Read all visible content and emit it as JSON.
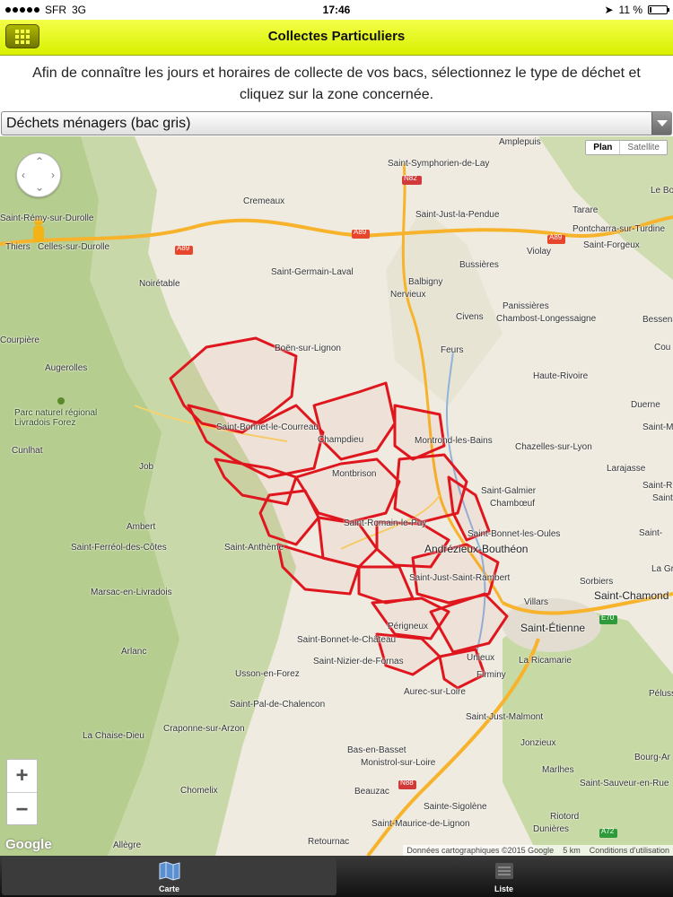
{
  "status": {
    "carrier": "SFR",
    "network": "3G",
    "time": "17:46",
    "battery": "11 %",
    "battery_level": 0.11
  },
  "nav": {
    "title": "Collectes Particuliers",
    "menu_icon": "grid-icon"
  },
  "intro": "Afin de connaître les jours et horaires de collecte de vos bacs, sélectionnez le type de déchet et cliquez sur la zone concernée.",
  "waste_select": {
    "value": "Déchets ménagers (bac gris)"
  },
  "map": {
    "type_plan": "Plan",
    "type_satellite": "Satellite",
    "zoom_in": "+",
    "zoom_out": "−",
    "google": "Google",
    "attribution": "Données cartographiques ©2015 Google",
    "scale": "5 km",
    "terms": "Conditions d'utilisation",
    "zone_color": "#e0161e",
    "places": {
      "amplepuis": "Amplepuis",
      "st_symphorien": "Saint-Symphorien-de-Lay",
      "cremeaux": "Cremeaux",
      "st_just_pendue": "Saint-Just-la-Pendue",
      "tarare": "Tarare",
      "le_bo": "Le Bo",
      "st_remy": "Saint-Rémy-sur-Durolle",
      "thiers": "Thiers",
      "celles": "Celles-sur-Durolle",
      "pontcharra": "Pontcharra-sur-Turdine",
      "violay": "Violay",
      "st_forgeux": "Saint-Forgeux",
      "st_germain_laval": "Saint-Germain-Laval",
      "bussieres": "Bussières",
      "noiretable": "Noirétable",
      "balbigny": "Balbigny",
      "nervieux": "Nervieux",
      "panissieres": "Panissières",
      "chambost": "Chambost-Longessaigne",
      "civens": "Civens",
      "bessenay": "Bessenay",
      "courpiere": "Courpière",
      "boen": "Boën-sur-Lignon",
      "feurs": "Feurs",
      "cou": "Cou",
      "augerolles": "Augerolles",
      "haute_rivoire": "Haute-Rivoire",
      "parc": "Parc naturel régional Livradois Forez",
      "duerne": "Duerne",
      "st_bonnet_coureau": "Saint-Bonnet-le-Courreau",
      "st_martin": "Saint-Martin",
      "cunlhat": "Cunlhat",
      "champdieu": "Champdieu",
      "montrond": "Montrond-les-Bains",
      "chazelles": "Chazelles-sur-Lyon",
      "job": "Job",
      "montbrison": "Montbrison",
      "larajasse": "Larajasse",
      "st_galmier": "Saint-Galmier",
      "chamboeuf": "Chambœuf",
      "st_r": "Saint-R",
      "st_d": "Saint-D",
      "ambert": "Ambert",
      "st_romain": "Saint-Romain-le-Puy",
      "st_bonnet_oules": "Saint-Bonnet-les-Oules",
      "st_ferreol": "Saint-Ferréol-des-Côtes",
      "st_anthème": "Saint-Anthème",
      "andrezieux": "Andrézieux-Bouthéon",
      "saint_r2": "Saint-",
      "la_gra": "La Gra",
      "st_just_rambert": "Saint-Just-Saint-Rambert",
      "sorbiers": "Sorbiers",
      "marsac": "Marsac-en-Livradois",
      "villars": "Villars",
      "st_chamond": "Saint-Chamond",
      "st_etienne": "Saint-Étienne",
      "perigneux": "Périgneux",
      "arlanc": "Arlanc",
      "st_bonnet_chateau": "Saint-Bonnet-le-Château",
      "unieux": "Unieux",
      "la_ricamarie": "La Ricamarie",
      "st_nizier": "Saint-Nizier-de-Fornas",
      "usson": "Usson-en-Forez",
      "firminy": "Firminy",
      "aurec": "Aurec-sur-Loire",
      "st_pal": "Saint-Pal-de-Chalencon",
      "pelussin": "Pélussi",
      "st_just_malmont": "Saint-Just-Malmont",
      "craponne": "Craponne-sur-Arzon",
      "la_chaise_dieu": "La Chaise-Dieu",
      "jonzieux": "Jonzieux",
      "bas_en_basset": "Bas-en-Basset",
      "monistrol": "Monistrol-sur-Loire",
      "bourg_ar": "Bourg-Ar",
      "marlhes": "Marlhes",
      "chomelix": "Chomelix",
      "beauzac": "Beauzac",
      "st_sauveur": "Saint-Sauveur-en-Rue",
      "ste_sigolene": "Sainte-Sigolène",
      "riotord": "Riotord",
      "st_maurice": "Saint-Maurice-de-Lignon",
      "dunieres": "Dunières",
      "allegre": "Allègre",
      "retournac": "Retournac"
    },
    "roads": {
      "a89a": "A89",
      "a89b": "A89",
      "a89c": "A89",
      "n82": "N82",
      "e70": "E70",
      "n88": "N88",
      "a72": "A72"
    }
  },
  "tabs": [
    {
      "label": "Carte",
      "icon": "map-icon"
    },
    {
      "label": "Liste",
      "icon": "list-icon"
    }
  ]
}
